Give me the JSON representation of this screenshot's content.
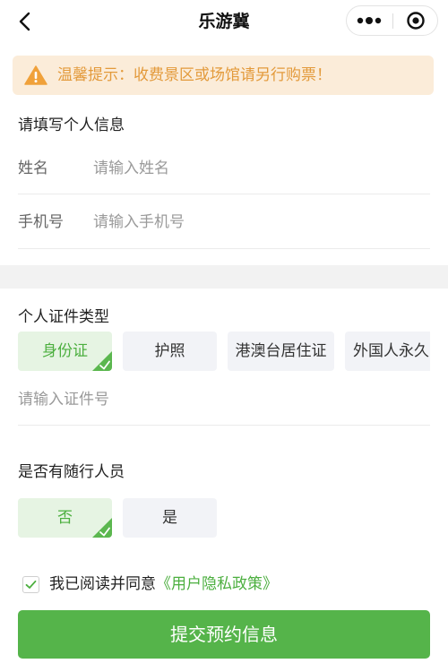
{
  "nav": {
    "title": "乐游冀",
    "back_icon": "chevron-left-icon",
    "more_icon": "more-dots-icon",
    "close_icon": "target-close-icon"
  },
  "notice": {
    "icon": "warning-icon",
    "text": "温馨提示：收费景区或场馆请另行购票！",
    "color": "#e39a3b",
    "background": "#fbecd9"
  },
  "personal_info": {
    "title": "请填写个人信息",
    "name": {
      "label": "姓名",
      "value": "",
      "placeholder": "请输入姓名"
    },
    "phone": {
      "label": "手机号",
      "value": "",
      "placeholder": "请输入手机号"
    }
  },
  "id_type": {
    "title": "个人证件类型",
    "options": [
      "身份证",
      "护照",
      "港澳台居住证",
      "外国人永久"
    ],
    "selected": "身份证",
    "id_number": {
      "value": "",
      "placeholder": "请输入证件号"
    }
  },
  "companions": {
    "title": "是否有随行人员",
    "options": [
      "否",
      "是"
    ],
    "selected": "否"
  },
  "agreement": {
    "checked": true,
    "text": "我已阅读并同意",
    "link": "《用户隐私政策》"
  },
  "submit": {
    "label": "提交预约信息",
    "color": "#55b44a"
  },
  "colors": {
    "accent": "#4caf3f",
    "chip_bg": "#f2f3f7",
    "chip_selected_bg": "#e6f4e3"
  }
}
